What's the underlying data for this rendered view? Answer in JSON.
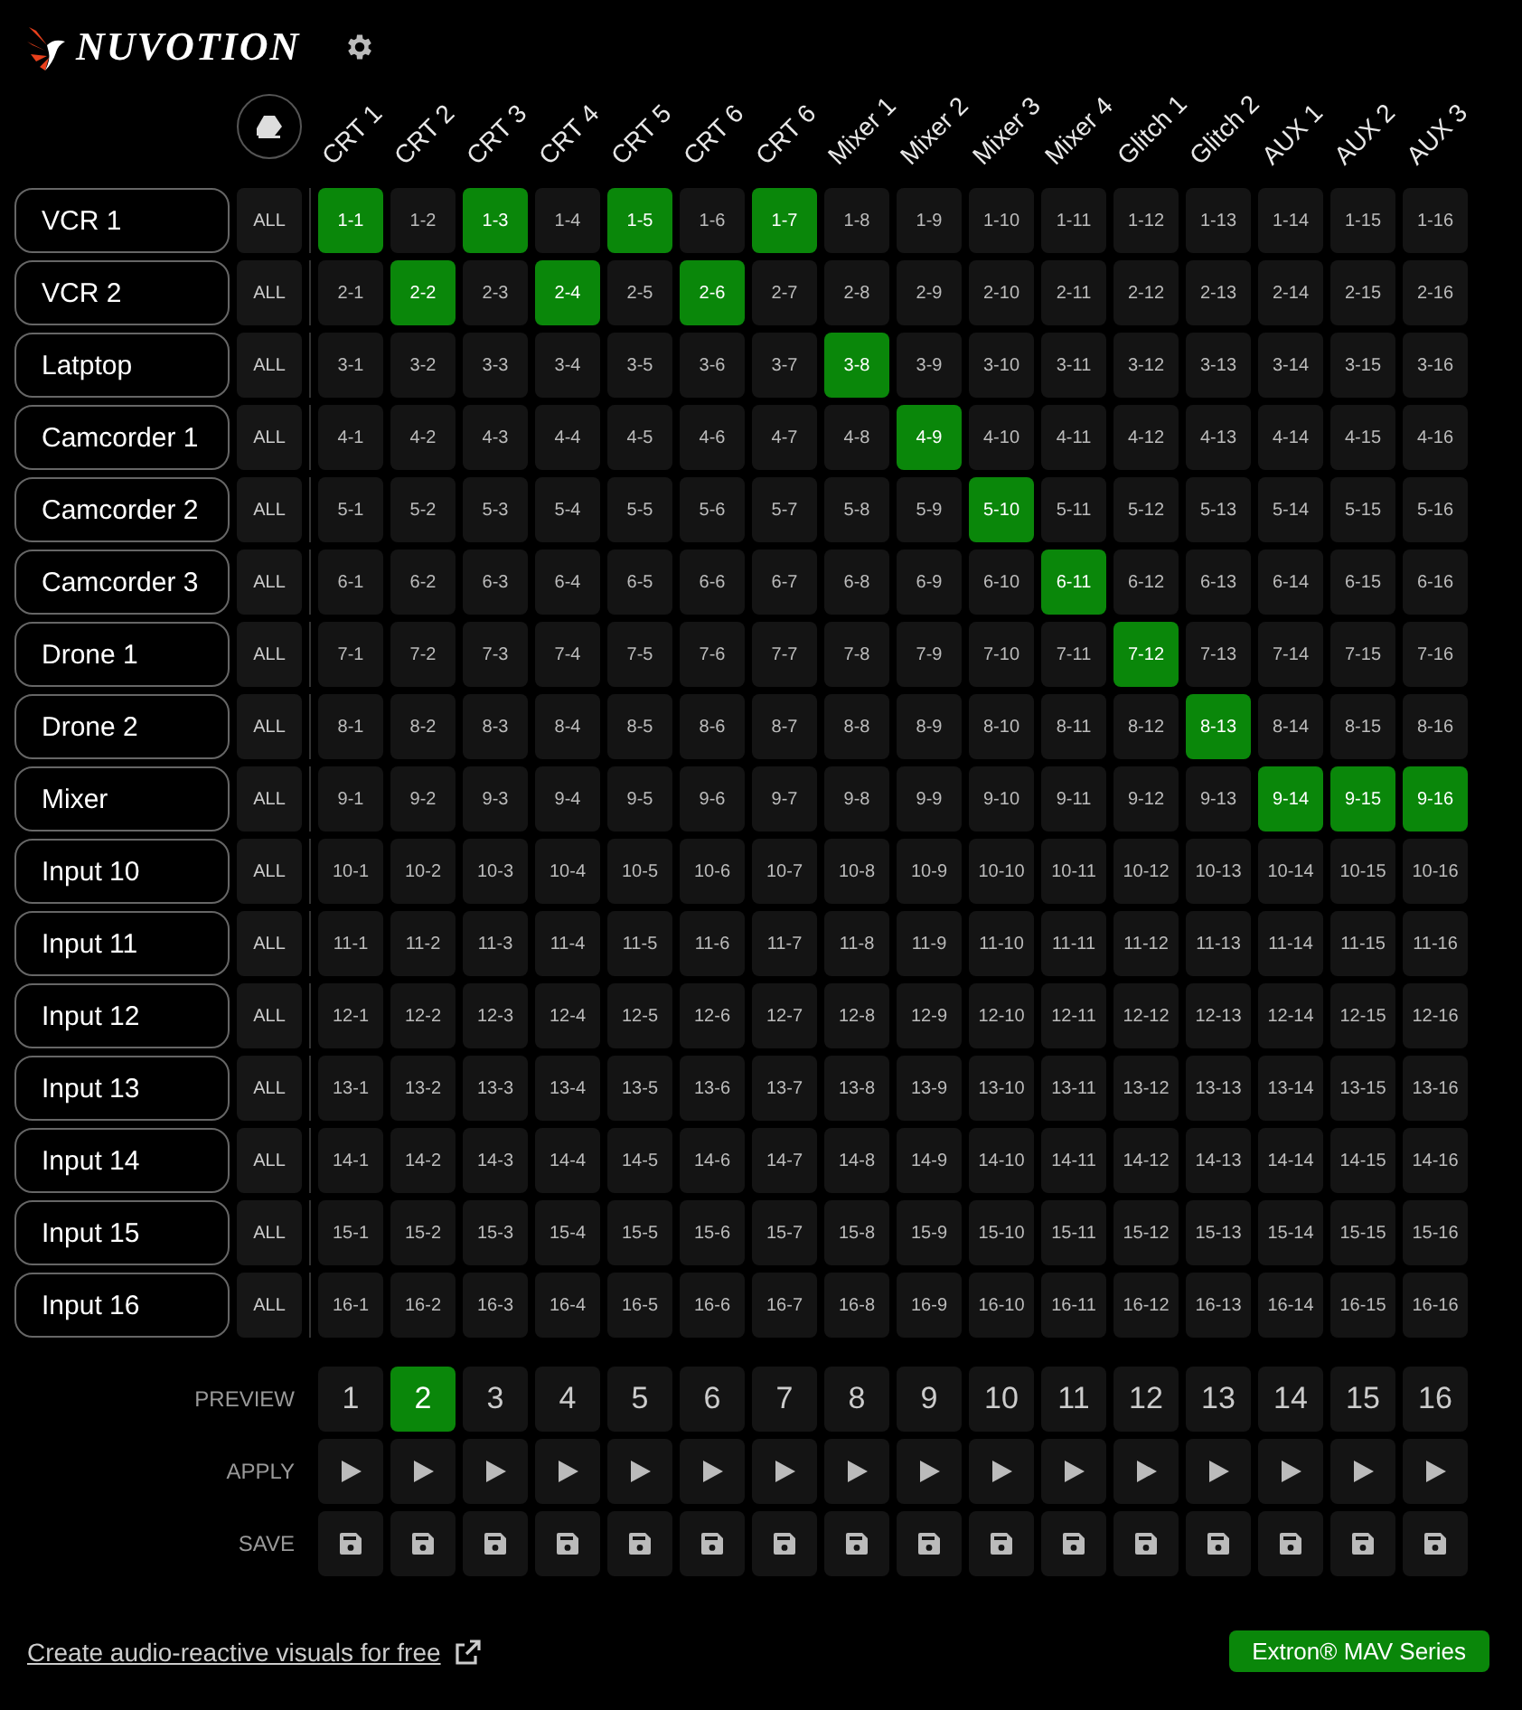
{
  "header": {
    "logo": "NUVOTION"
  },
  "outputs": [
    "CRT 1",
    "CRT 2",
    "CRT 3",
    "CRT 4",
    "CRT 5",
    "CRT 6",
    "CRT 6",
    "Mixer 1",
    "Mixer 2",
    "Mixer 3",
    "Mixer 4",
    "Glitch 1",
    "Glitch 2",
    "AUX 1",
    "AUX 2",
    "AUX 3"
  ],
  "inputs": [
    {
      "name": "VCR 1",
      "all": "ALL",
      "cells": [
        {
          "label": "1-1",
          "selected": true
        },
        {
          "label": "1-2",
          "selected": false
        },
        {
          "label": "1-3",
          "selected": true
        },
        {
          "label": "1-4",
          "selected": false
        },
        {
          "label": "1-5",
          "selected": true
        },
        {
          "label": "1-6",
          "selected": false
        },
        {
          "label": "1-7",
          "selected": true
        },
        {
          "label": "1-8",
          "selected": false
        },
        {
          "label": "1-9",
          "selected": false
        },
        {
          "label": "1-10",
          "selected": false
        },
        {
          "label": "1-11",
          "selected": false
        },
        {
          "label": "1-12",
          "selected": false
        },
        {
          "label": "1-13",
          "selected": false
        },
        {
          "label": "1-14",
          "selected": false
        },
        {
          "label": "1-15",
          "selected": false
        },
        {
          "label": "1-16",
          "selected": false
        }
      ]
    },
    {
      "name": "VCR 2",
      "all": "ALL",
      "cells": [
        {
          "label": "2-1",
          "selected": false
        },
        {
          "label": "2-2",
          "selected": true
        },
        {
          "label": "2-3",
          "selected": false
        },
        {
          "label": "2-4",
          "selected": true
        },
        {
          "label": "2-5",
          "selected": false
        },
        {
          "label": "2-6",
          "selected": true
        },
        {
          "label": "2-7",
          "selected": false
        },
        {
          "label": "2-8",
          "selected": false
        },
        {
          "label": "2-9",
          "selected": false
        },
        {
          "label": "2-10",
          "selected": false
        },
        {
          "label": "2-11",
          "selected": false
        },
        {
          "label": "2-12",
          "selected": false
        },
        {
          "label": "2-13",
          "selected": false
        },
        {
          "label": "2-14",
          "selected": false
        },
        {
          "label": "2-15",
          "selected": false
        },
        {
          "label": "2-16",
          "selected": false
        }
      ]
    },
    {
      "name": "Latptop",
      "all": "ALL",
      "cells": [
        {
          "label": "3-1",
          "selected": false
        },
        {
          "label": "3-2",
          "selected": false
        },
        {
          "label": "3-3",
          "selected": false
        },
        {
          "label": "3-4",
          "selected": false
        },
        {
          "label": "3-5",
          "selected": false
        },
        {
          "label": "3-6",
          "selected": false
        },
        {
          "label": "3-7",
          "selected": false
        },
        {
          "label": "3-8",
          "selected": true
        },
        {
          "label": "3-9",
          "selected": false
        },
        {
          "label": "3-10",
          "selected": false
        },
        {
          "label": "3-11",
          "selected": false
        },
        {
          "label": "3-12",
          "selected": false
        },
        {
          "label": "3-13",
          "selected": false
        },
        {
          "label": "3-14",
          "selected": false
        },
        {
          "label": "3-15",
          "selected": false
        },
        {
          "label": "3-16",
          "selected": false
        }
      ]
    },
    {
      "name": "Camcorder 1",
      "all": "ALL",
      "cells": [
        {
          "label": "4-1",
          "selected": false
        },
        {
          "label": "4-2",
          "selected": false
        },
        {
          "label": "4-3",
          "selected": false
        },
        {
          "label": "4-4",
          "selected": false
        },
        {
          "label": "4-5",
          "selected": false
        },
        {
          "label": "4-6",
          "selected": false
        },
        {
          "label": "4-7",
          "selected": false
        },
        {
          "label": "4-8",
          "selected": false
        },
        {
          "label": "4-9",
          "selected": true
        },
        {
          "label": "4-10",
          "selected": false
        },
        {
          "label": "4-11",
          "selected": false
        },
        {
          "label": "4-12",
          "selected": false
        },
        {
          "label": "4-13",
          "selected": false
        },
        {
          "label": "4-14",
          "selected": false
        },
        {
          "label": "4-15",
          "selected": false
        },
        {
          "label": "4-16",
          "selected": false
        }
      ]
    },
    {
      "name": "Camcorder 2",
      "all": "ALL",
      "cells": [
        {
          "label": "5-1",
          "selected": false
        },
        {
          "label": "5-2",
          "selected": false
        },
        {
          "label": "5-3",
          "selected": false
        },
        {
          "label": "5-4",
          "selected": false
        },
        {
          "label": "5-5",
          "selected": false
        },
        {
          "label": "5-6",
          "selected": false
        },
        {
          "label": "5-7",
          "selected": false
        },
        {
          "label": "5-8",
          "selected": false
        },
        {
          "label": "5-9",
          "selected": false
        },
        {
          "label": "5-10",
          "selected": true
        },
        {
          "label": "5-11",
          "selected": false
        },
        {
          "label": "5-12",
          "selected": false
        },
        {
          "label": "5-13",
          "selected": false
        },
        {
          "label": "5-14",
          "selected": false
        },
        {
          "label": "5-15",
          "selected": false
        },
        {
          "label": "5-16",
          "selected": false
        }
      ]
    },
    {
      "name": "Camcorder 3",
      "all": "ALL",
      "cells": [
        {
          "label": "6-1",
          "selected": false
        },
        {
          "label": "6-2",
          "selected": false
        },
        {
          "label": "6-3",
          "selected": false
        },
        {
          "label": "6-4",
          "selected": false
        },
        {
          "label": "6-5",
          "selected": false
        },
        {
          "label": "6-6",
          "selected": false
        },
        {
          "label": "6-7",
          "selected": false
        },
        {
          "label": "6-8",
          "selected": false
        },
        {
          "label": "6-9",
          "selected": false
        },
        {
          "label": "6-10",
          "selected": false
        },
        {
          "label": "6-11",
          "selected": true
        },
        {
          "label": "6-12",
          "selected": false
        },
        {
          "label": "6-13",
          "selected": false
        },
        {
          "label": "6-14",
          "selected": false
        },
        {
          "label": "6-15",
          "selected": false
        },
        {
          "label": "6-16",
          "selected": false
        }
      ]
    },
    {
      "name": "Drone 1",
      "all": "ALL",
      "cells": [
        {
          "label": "7-1",
          "selected": false
        },
        {
          "label": "7-2",
          "selected": false
        },
        {
          "label": "7-3",
          "selected": false
        },
        {
          "label": "7-4",
          "selected": false
        },
        {
          "label": "7-5",
          "selected": false
        },
        {
          "label": "7-6",
          "selected": false
        },
        {
          "label": "7-7",
          "selected": false
        },
        {
          "label": "7-8",
          "selected": false
        },
        {
          "label": "7-9",
          "selected": false
        },
        {
          "label": "7-10",
          "selected": false
        },
        {
          "label": "7-11",
          "selected": false
        },
        {
          "label": "7-12",
          "selected": true
        },
        {
          "label": "7-13",
          "selected": false
        },
        {
          "label": "7-14",
          "selected": false
        },
        {
          "label": "7-15",
          "selected": false
        },
        {
          "label": "7-16",
          "selected": false
        }
      ]
    },
    {
      "name": "Drone 2",
      "all": "ALL",
      "cells": [
        {
          "label": "8-1",
          "selected": false
        },
        {
          "label": "8-2",
          "selected": false
        },
        {
          "label": "8-3",
          "selected": false
        },
        {
          "label": "8-4",
          "selected": false
        },
        {
          "label": "8-5",
          "selected": false
        },
        {
          "label": "8-6",
          "selected": false
        },
        {
          "label": "8-7",
          "selected": false
        },
        {
          "label": "8-8",
          "selected": false
        },
        {
          "label": "8-9",
          "selected": false
        },
        {
          "label": "8-10",
          "selected": false
        },
        {
          "label": "8-11",
          "selected": false
        },
        {
          "label": "8-12",
          "selected": false
        },
        {
          "label": "8-13",
          "selected": true
        },
        {
          "label": "8-14",
          "selected": false
        },
        {
          "label": "8-15",
          "selected": false
        },
        {
          "label": "8-16",
          "selected": false
        }
      ]
    },
    {
      "name": "Mixer",
      "all": "ALL",
      "cells": [
        {
          "label": "9-1",
          "selected": false
        },
        {
          "label": "9-2",
          "selected": false
        },
        {
          "label": "9-3",
          "selected": false
        },
        {
          "label": "9-4",
          "selected": false
        },
        {
          "label": "9-5",
          "selected": false
        },
        {
          "label": "9-6",
          "selected": false
        },
        {
          "label": "9-7",
          "selected": false
        },
        {
          "label": "9-8",
          "selected": false
        },
        {
          "label": "9-9",
          "selected": false
        },
        {
          "label": "9-10",
          "selected": false
        },
        {
          "label": "9-11",
          "selected": false
        },
        {
          "label": "9-12",
          "selected": false
        },
        {
          "label": "9-13",
          "selected": false
        },
        {
          "label": "9-14",
          "selected": true
        },
        {
          "label": "9-15",
          "selected": true
        },
        {
          "label": "9-16",
          "selected": true
        }
      ]
    },
    {
      "name": "Input 10",
      "all": "ALL",
      "cells": [
        {
          "label": "10-1",
          "selected": false
        },
        {
          "label": "10-2",
          "selected": false
        },
        {
          "label": "10-3",
          "selected": false
        },
        {
          "label": "10-4",
          "selected": false
        },
        {
          "label": "10-5",
          "selected": false
        },
        {
          "label": "10-6",
          "selected": false
        },
        {
          "label": "10-7",
          "selected": false
        },
        {
          "label": "10-8",
          "selected": false
        },
        {
          "label": "10-9",
          "selected": false
        },
        {
          "label": "10-10",
          "selected": false
        },
        {
          "label": "10-11",
          "selected": false
        },
        {
          "label": "10-12",
          "selected": false
        },
        {
          "label": "10-13",
          "selected": false
        },
        {
          "label": "10-14",
          "selected": false
        },
        {
          "label": "10-15",
          "selected": false
        },
        {
          "label": "10-16",
          "selected": false
        }
      ]
    },
    {
      "name": "Input 11",
      "all": "ALL",
      "cells": [
        {
          "label": "11-1",
          "selected": false
        },
        {
          "label": "11-2",
          "selected": false
        },
        {
          "label": "11-3",
          "selected": false
        },
        {
          "label": "11-4",
          "selected": false
        },
        {
          "label": "11-5",
          "selected": false
        },
        {
          "label": "11-6",
          "selected": false
        },
        {
          "label": "11-7",
          "selected": false
        },
        {
          "label": "11-8",
          "selected": false
        },
        {
          "label": "11-9",
          "selected": false
        },
        {
          "label": "11-10",
          "selected": false
        },
        {
          "label": "11-11",
          "selected": false
        },
        {
          "label": "11-12",
          "selected": false
        },
        {
          "label": "11-13",
          "selected": false
        },
        {
          "label": "11-14",
          "selected": false
        },
        {
          "label": "11-15",
          "selected": false
        },
        {
          "label": "11-16",
          "selected": false
        }
      ]
    },
    {
      "name": "Input 12",
      "all": "ALL",
      "cells": [
        {
          "label": "12-1",
          "selected": false
        },
        {
          "label": "12-2",
          "selected": false
        },
        {
          "label": "12-3",
          "selected": false
        },
        {
          "label": "12-4",
          "selected": false
        },
        {
          "label": "12-5",
          "selected": false
        },
        {
          "label": "12-6",
          "selected": false
        },
        {
          "label": "12-7",
          "selected": false
        },
        {
          "label": "12-8",
          "selected": false
        },
        {
          "label": "12-9",
          "selected": false
        },
        {
          "label": "12-10",
          "selected": false
        },
        {
          "label": "12-11",
          "selected": false
        },
        {
          "label": "12-12",
          "selected": false
        },
        {
          "label": "12-13",
          "selected": false
        },
        {
          "label": "12-14",
          "selected": false
        },
        {
          "label": "12-15",
          "selected": false
        },
        {
          "label": "12-16",
          "selected": false
        }
      ]
    },
    {
      "name": "Input 13",
      "all": "ALL",
      "cells": [
        {
          "label": "13-1",
          "selected": false
        },
        {
          "label": "13-2",
          "selected": false
        },
        {
          "label": "13-3",
          "selected": false
        },
        {
          "label": "13-4",
          "selected": false
        },
        {
          "label": "13-5",
          "selected": false
        },
        {
          "label": "13-6",
          "selected": false
        },
        {
          "label": "13-7",
          "selected": false
        },
        {
          "label": "13-8",
          "selected": false
        },
        {
          "label": "13-9",
          "selected": false
        },
        {
          "label": "13-10",
          "selected": false
        },
        {
          "label": "13-11",
          "selected": false
        },
        {
          "label": "13-12",
          "selected": false
        },
        {
          "label": "13-13",
          "selected": false
        },
        {
          "label": "13-14",
          "selected": false
        },
        {
          "label": "13-15",
          "selected": false
        },
        {
          "label": "13-16",
          "selected": false
        }
      ]
    },
    {
      "name": "Input 14",
      "all": "ALL",
      "cells": [
        {
          "label": "14-1",
          "selected": false
        },
        {
          "label": "14-2",
          "selected": false
        },
        {
          "label": "14-3",
          "selected": false
        },
        {
          "label": "14-4",
          "selected": false
        },
        {
          "label": "14-5",
          "selected": false
        },
        {
          "label": "14-6",
          "selected": false
        },
        {
          "label": "14-7",
          "selected": false
        },
        {
          "label": "14-8",
          "selected": false
        },
        {
          "label": "14-9",
          "selected": false
        },
        {
          "label": "14-10",
          "selected": false
        },
        {
          "label": "14-11",
          "selected": false
        },
        {
          "label": "14-12",
          "selected": false
        },
        {
          "label": "14-13",
          "selected": false
        },
        {
          "label": "14-14",
          "selected": false
        },
        {
          "label": "14-15",
          "selected": false
        },
        {
          "label": "14-16",
          "selected": false
        }
      ]
    },
    {
      "name": "Input 15",
      "all": "ALL",
      "cells": [
        {
          "label": "15-1",
          "selected": false
        },
        {
          "label": "15-2",
          "selected": false
        },
        {
          "label": "15-3",
          "selected": false
        },
        {
          "label": "15-4",
          "selected": false
        },
        {
          "label": "15-5",
          "selected": false
        },
        {
          "label": "15-6",
          "selected": false
        },
        {
          "label": "15-7",
          "selected": false
        },
        {
          "label": "15-8",
          "selected": false
        },
        {
          "label": "15-9",
          "selected": false
        },
        {
          "label": "15-10",
          "selected": false
        },
        {
          "label": "15-11",
          "selected": false
        },
        {
          "label": "15-12",
          "selected": false
        },
        {
          "label": "15-13",
          "selected": false
        },
        {
          "label": "15-14",
          "selected": false
        },
        {
          "label": "15-15",
          "selected": false
        },
        {
          "label": "15-16",
          "selected": false
        }
      ]
    },
    {
      "name": "Input 16",
      "all": "ALL",
      "cells": [
        {
          "label": "16-1",
          "selected": false
        },
        {
          "label": "16-2",
          "selected": false
        },
        {
          "label": "16-3",
          "selected": false
        },
        {
          "label": "16-4",
          "selected": false
        },
        {
          "label": "16-5",
          "selected": false
        },
        {
          "label": "16-6",
          "selected": false
        },
        {
          "label": "16-7",
          "selected": false
        },
        {
          "label": "16-8",
          "selected": false
        },
        {
          "label": "16-9",
          "selected": false
        },
        {
          "label": "16-10",
          "selected": false
        },
        {
          "label": "16-11",
          "selected": false
        },
        {
          "label": "16-12",
          "selected": false
        },
        {
          "label": "16-13",
          "selected": false
        },
        {
          "label": "16-14",
          "selected": false
        },
        {
          "label": "16-15",
          "selected": false
        },
        {
          "label": "16-16",
          "selected": false
        }
      ]
    }
  ],
  "presets": {
    "preview_label": "PREVIEW",
    "apply_label": "APPLY",
    "save_label": "SAVE",
    "items": [
      {
        "number": "1",
        "selected": false
      },
      {
        "number": "2",
        "selected": true
      },
      {
        "number": "3",
        "selected": false
      },
      {
        "number": "4",
        "selected": false
      },
      {
        "number": "5",
        "selected": false
      },
      {
        "number": "6",
        "selected": false
      },
      {
        "number": "7",
        "selected": false
      },
      {
        "number": "8",
        "selected": false
      },
      {
        "number": "9",
        "selected": false
      },
      {
        "number": "10",
        "selected": false
      },
      {
        "number": "11",
        "selected": false
      },
      {
        "number": "12",
        "selected": false
      },
      {
        "number": "13",
        "selected": false
      },
      {
        "number": "14",
        "selected": false
      },
      {
        "number": "15",
        "selected": false
      },
      {
        "number": "16",
        "selected": false
      }
    ]
  },
  "footer": {
    "link": "Create audio-reactive visuals for free",
    "badge": "Extron® MAV Series"
  }
}
